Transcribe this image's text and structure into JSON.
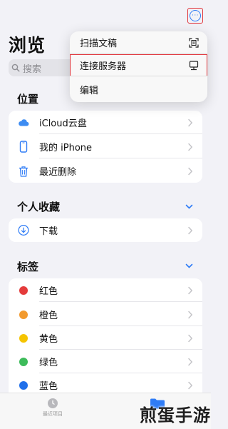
{
  "header": {
    "title": "浏览"
  },
  "search": {
    "placeholder": "搜索"
  },
  "menu": {
    "items": [
      {
        "label": "扫描文稿",
        "icon": "scan-icon"
      },
      {
        "label": "连接服务器",
        "icon": "server-icon"
      },
      {
        "label": "编辑"
      }
    ]
  },
  "sections": {
    "locations": {
      "title": "位置",
      "items": [
        {
          "label": "iCloud云盘",
          "icon": "icloud-icon"
        },
        {
          "label": "我的 iPhone",
          "icon": "iphone-icon"
        },
        {
          "label": "最近删除",
          "icon": "trash-icon"
        }
      ]
    },
    "favorites": {
      "title": "个人收藏",
      "items": [
        {
          "label": "下载",
          "icon": "download-icon"
        }
      ]
    },
    "tags": {
      "title": "标签",
      "items": [
        {
          "label": "红色",
          "color": "#e43b3b"
        },
        {
          "label": "橙色",
          "color": "#f29a2e"
        },
        {
          "label": "黄色",
          "color": "#f5c400"
        },
        {
          "label": "绿色",
          "color": "#3dbb5a"
        },
        {
          "label": "蓝色",
          "color": "#1f6fea"
        }
      ]
    }
  },
  "tabbar": {
    "recents_label": "最近项目"
  },
  "watermark": {
    "text": "煎蛋手游"
  },
  "colors": {
    "accent": "#2f7cf6",
    "highlight_border": "#e0353b"
  }
}
